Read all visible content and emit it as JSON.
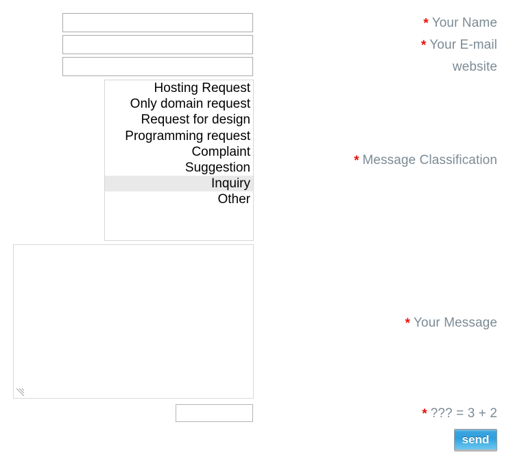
{
  "form": {
    "required_marker": "*",
    "accent_required_color": "#e8120c",
    "label_color": "#7c8b95",
    "fields": {
      "name": {
        "label": "Your Name",
        "required": true,
        "value": "",
        "placeholder": ""
      },
      "email": {
        "label": "Your E-mail",
        "required": true,
        "value": "",
        "placeholder": ""
      },
      "website": {
        "label": "website",
        "required": false,
        "value": "",
        "placeholder": ""
      },
      "classification": {
        "label": "Message Classification",
        "required": true,
        "selected": "Inquiry",
        "options": [
          "Hosting Request",
          "Only domain request",
          "Request for design",
          "Programming request",
          "Complaint",
          "Suggestion",
          "Inquiry",
          "Other"
        ]
      },
      "message": {
        "label": "Your Message",
        "required": true,
        "value": "",
        "placeholder": ""
      },
      "captcha": {
        "label": "??? = 3 + 2",
        "required": true,
        "value": "",
        "placeholder": ""
      }
    },
    "submit": {
      "label": "send",
      "button_color": "#2e9fdd"
    },
    "icons": {
      "resize_grip": "resize-grip-icon"
    }
  }
}
